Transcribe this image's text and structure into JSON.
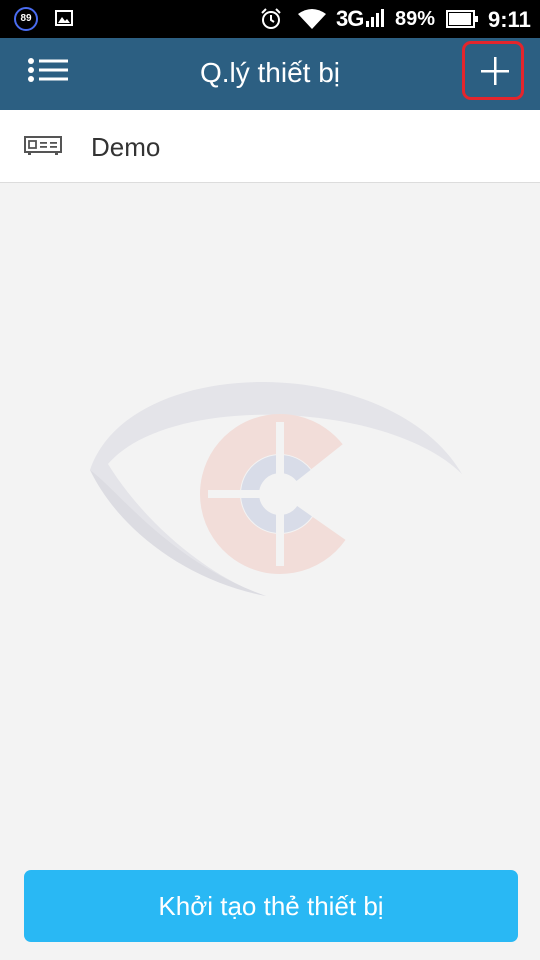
{
  "status_bar": {
    "badge_count": "89",
    "network": "3G",
    "battery_percent": "89%",
    "time": "9:11",
    "icons": [
      "notification-badge-icon",
      "gallery-icon",
      "alarm-icon",
      "wifi-icon",
      "signal-icon",
      "battery-icon"
    ]
  },
  "app_bar": {
    "title": "Q.lý thiết bị",
    "menu_icon": "menu-list-icon",
    "add_icon": "plus-icon",
    "color": "#2c5f82",
    "highlight_color": "#e4252c"
  },
  "devices": [
    {
      "name": "Demo",
      "icon": "dvr-recorder-icon"
    }
  ],
  "watermark": {
    "icon": "eye-logo-watermark"
  },
  "footer": {
    "create_button_label": "Khởi tạo thẻ thiết bị",
    "button_color": "#29b8f4"
  }
}
